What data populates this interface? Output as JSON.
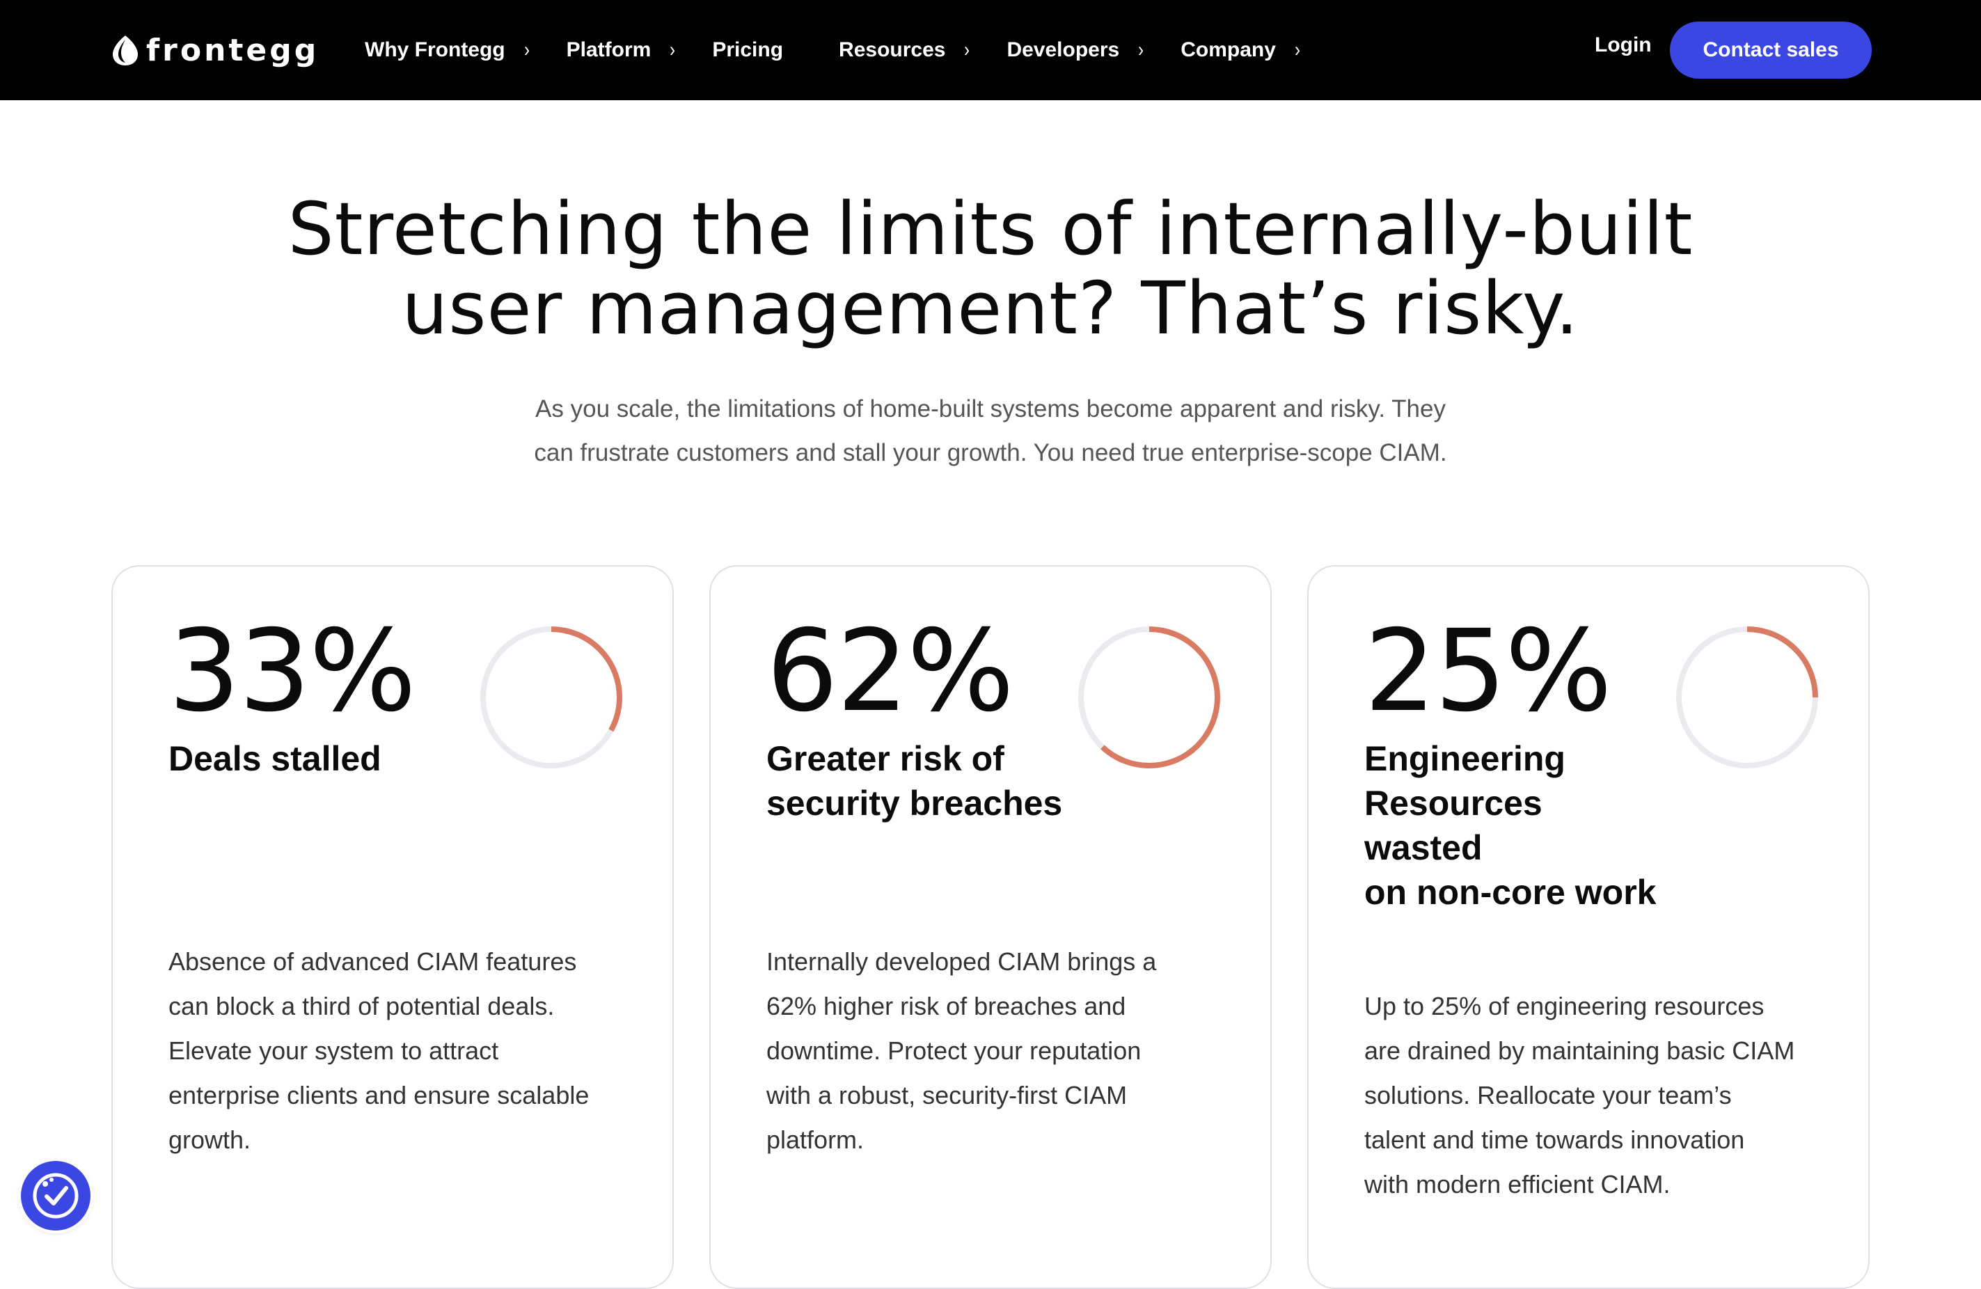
{
  "nav": {
    "logo_text": "frontegg",
    "items": [
      {
        "label": "Why Frontegg",
        "has_submenu": true
      },
      {
        "label": "Platform",
        "has_submenu": true
      },
      {
        "label": "Pricing",
        "has_submenu": false
      },
      {
        "label": "Resources",
        "has_submenu": true
      },
      {
        "label": "Developers",
        "has_submenu": true
      },
      {
        "label": "Company",
        "has_submenu": true
      }
    ],
    "submenu_glyph": "›",
    "login_label": "Login",
    "contact_label": "Contact sales"
  },
  "hero": {
    "headline_lines": [
      "Stretching the limits of internally-built",
      "user management? That’s risky."
    ],
    "sub_lines": [
      "As you scale, the limitations of home-built systems become apparent and risky. They",
      "can frustrate customers and stall your growth. You need true enterprise-scope CIAM."
    ]
  },
  "stats": [
    {
      "value": "33%",
      "fraction": 0.33,
      "title_lines": [
        "Deals stalled"
      ],
      "desc_lines": [
        "Absence of advanced CIAM features",
        "can block a third of potential deals.",
        "Elevate your system to attract",
        "enterprise clients and ensure scalable",
        "growth."
      ]
    },
    {
      "value": "62%",
      "fraction": 0.62,
      "title_lines": [
        "Greater risk of",
        "security breaches"
      ],
      "desc_lines": [
        "Internally developed CIAM brings a",
        "62% higher risk of breaches and",
        "downtime. Protect your reputation",
        "with a robust, security-first CIAM",
        "platform."
      ]
    },
    {
      "value": "25%",
      "fraction": 0.25,
      "title_lines": [
        "Engineering",
        "Resources",
        "wasted",
        "on non-core work"
      ],
      "desc_lines": [
        "Up to 25% of engineering resources",
        "are drained by maintaining basic CIAM",
        "solutions. Reallocate your team’s",
        "talent and time towards innovation",
        "with modern efficient CIAM."
      ]
    }
  ],
  "colors": {
    "nav_bg": "#000000",
    "accent": "#3b47e3",
    "ring_progress": "#d97b62",
    "ring_track": "#ebebef"
  },
  "icons": {
    "logo": "frontegg-drop-logo",
    "accessibility": "accessibility-check-icon"
  }
}
